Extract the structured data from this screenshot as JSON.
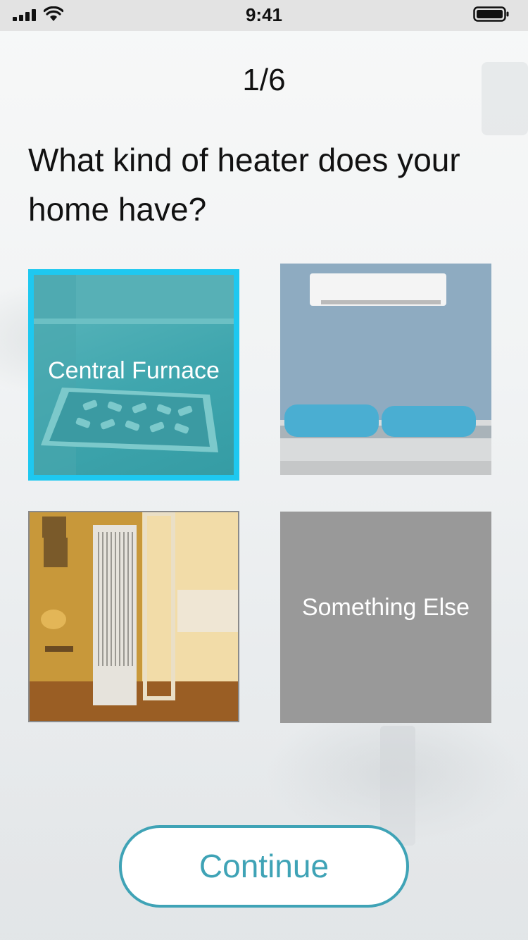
{
  "status_bar": {
    "time": "9:41"
  },
  "quiz": {
    "progress": "1/6",
    "question": "What kind of heater does your home have?"
  },
  "options": [
    {
      "label": "Central Furnace",
      "selected": true,
      "image": "floor-vent-image"
    },
    {
      "label": "",
      "selected": false,
      "image": "wall-mounted-ac-image"
    },
    {
      "label": "",
      "selected": false,
      "image": "wall-heater-image"
    },
    {
      "label": "Something Else",
      "selected": false,
      "image": null
    }
  ],
  "actions": {
    "continue_label": "Continue"
  },
  "colors": {
    "accent": "#3fa3b6",
    "selected_border": "#1ec8f0",
    "placeholder_tile": "#999999",
    "status_bar": "#e3e3e3"
  }
}
